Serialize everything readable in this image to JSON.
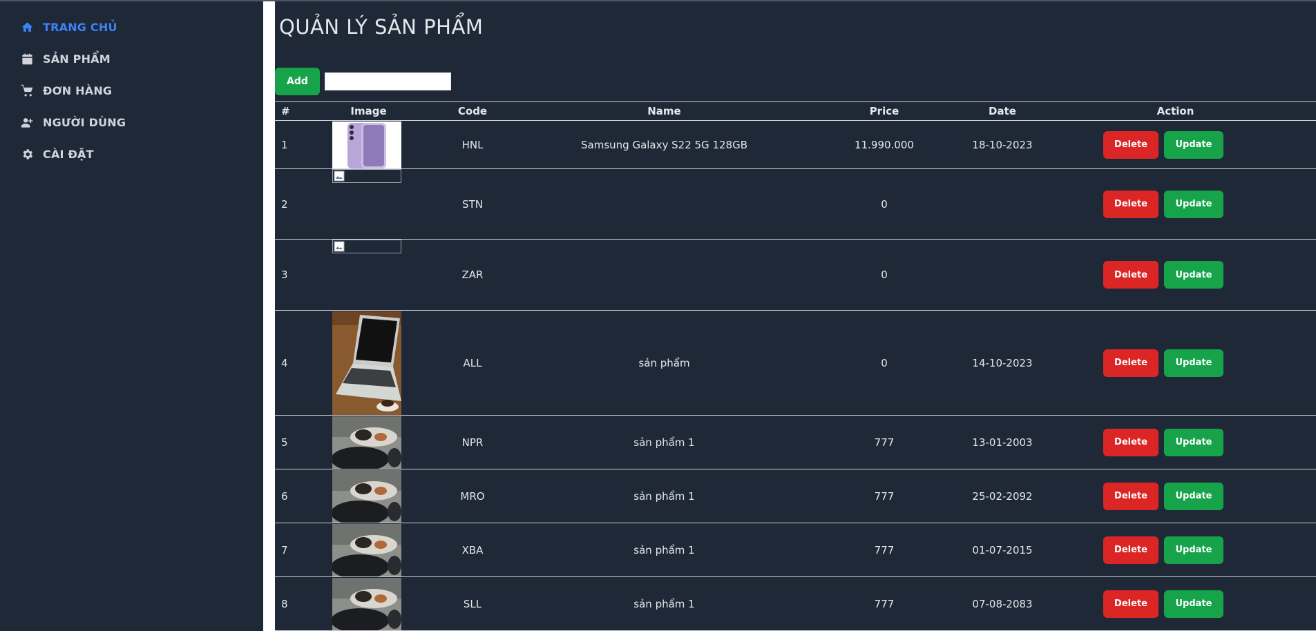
{
  "sidebar": {
    "items": [
      {
        "label": "TRANG CHỦ",
        "icon": "home-icon",
        "active": true
      },
      {
        "label": "SẢN PHẨM",
        "icon": "calendar-icon",
        "active": false
      },
      {
        "label": "ĐƠN HÀNG",
        "icon": "cart-icon",
        "active": false
      },
      {
        "label": "NGƯỜI DÙNG",
        "icon": "user-plus-icon",
        "active": false
      },
      {
        "label": "CÀI ĐẶT",
        "icon": "gear-icon",
        "active": false
      }
    ]
  },
  "main": {
    "title": "QUẢN LÝ SẢN PHẨM",
    "add_label": "Add",
    "search_value": ""
  },
  "table": {
    "headers": [
      "#",
      "Image",
      "Code",
      "Name",
      "Price",
      "Date",
      "Action"
    ],
    "delete_label": "Delete",
    "update_label": "Update",
    "rows": [
      {
        "num": "1",
        "image": "phone",
        "code": "HNL",
        "name": "Samsung Galaxy S22 5G 128GB",
        "price": "11.990.000",
        "date": "18-10-2023"
      },
      {
        "num": "2",
        "image": "broken",
        "code": "STN",
        "name": "",
        "price": "0",
        "date": ""
      },
      {
        "num": "3",
        "image": "broken",
        "code": "ZAR",
        "name": "",
        "price": "0",
        "date": ""
      },
      {
        "num": "4",
        "image": "laptop",
        "code": "ALL",
        "name": "sản phẩm",
        "price": "0",
        "date": "14-10-2023"
      },
      {
        "num": "5",
        "image": "cat",
        "code": "NPR",
        "name": "sản phẩm 1",
        "price": "777",
        "date": "13-01-2003"
      },
      {
        "num": "6",
        "image": "cat",
        "code": "MRO",
        "name": "sản phẩm 1",
        "price": "777",
        "date": "25-02-2092"
      },
      {
        "num": "7",
        "image": "cat",
        "code": "XBA",
        "name": "sản phẩm 1",
        "price": "777",
        "date": "01-07-2015"
      },
      {
        "num": "8",
        "image": "cat",
        "code": "SLL",
        "name": "sản phẩm 1",
        "price": "777",
        "date": "07-08-2083"
      }
    ]
  },
  "colors": {
    "background": "#1f2837",
    "accent": "#3b82f6",
    "add": "#16a34a",
    "delete": "#dc2626",
    "update": "#16a34a"
  }
}
